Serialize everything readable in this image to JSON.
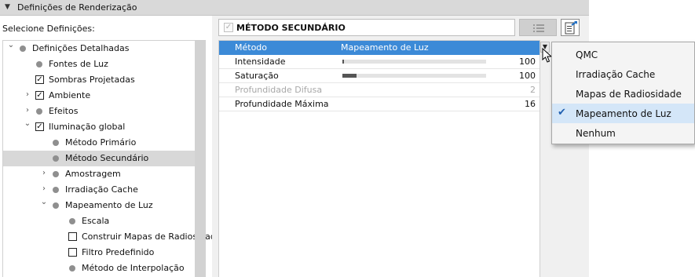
{
  "header": {
    "title": "Definições de Renderização"
  },
  "left": {
    "label": "Selecione Definições:",
    "tree": [
      {
        "label": "Definições Detalhadas",
        "chevron": "down"
      },
      {
        "label": "Fontes de Luz"
      },
      {
        "label": "Sombras Projetadas",
        "checked": true
      },
      {
        "label": "Ambiente",
        "checked": true,
        "chevron": "right"
      },
      {
        "label": "Efeitos",
        "chevron": "right"
      },
      {
        "label": "Iluminação global",
        "checked": true,
        "chevron": "down"
      },
      {
        "label": "Método Primário"
      },
      {
        "label": "Método Secundário",
        "selected": true
      },
      {
        "label": "Amostragem",
        "chevron": "right"
      },
      {
        "label": "Irradiação Cache",
        "chevron": "right"
      },
      {
        "label": "Mapeamento de Luz",
        "chevron": "down"
      },
      {
        "label": "Escala"
      },
      {
        "label": "Construir Mapas de Radiosidade",
        "checked": false
      },
      {
        "label": "Filtro Predefinido",
        "checked": false
      },
      {
        "label": "Método de Interpolação"
      }
    ]
  },
  "section": {
    "title": "MÉTODO SECUNDÁRIO",
    "checkmark": "✓"
  },
  "properties": [
    {
      "name": "Método",
      "value": "Mapeamento de Luz"
    },
    {
      "name": "Intensidade",
      "number": "100",
      "slider": 0.01
    },
    {
      "name": "Saturação",
      "number": "100",
      "slider": 0.1
    },
    {
      "name": "Profundidade Difusa",
      "number": "2",
      "disabled": true
    },
    {
      "name": "Profundidade Máxima",
      "number": "16"
    }
  ],
  "dropdown": {
    "options": [
      "QMC",
      "Irradiação Cache",
      "Mapas de Radiosidade",
      "Mapeamento de Luz",
      "Nenhum"
    ],
    "selected": "Mapeamento de Luz",
    "check_glyph": "✔",
    "arrow_glyph": "▼"
  },
  "icons": {
    "collapse": "▼",
    "chevron_down": "⌄",
    "chevron_right": "›"
  },
  "colors": {
    "selection": "#3c8ad7",
    "menu_checked_bg": "#d4e6f8",
    "tree_selected_bg": "#d8d8d8"
  }
}
